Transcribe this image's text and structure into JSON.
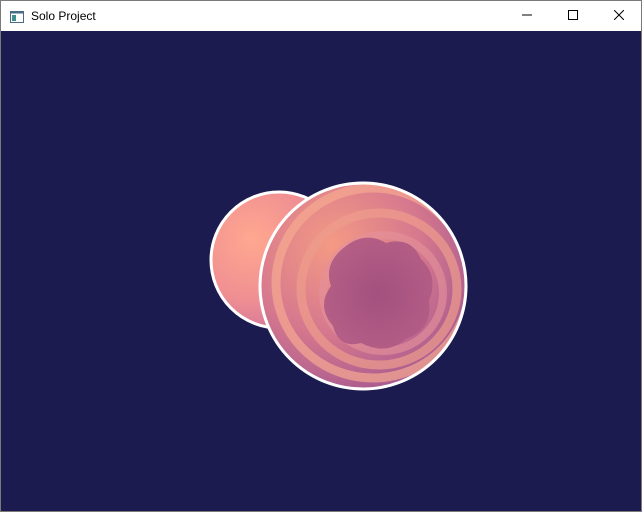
{
  "window": {
    "title": "Solo Project",
    "app_icon": "window-app-icon",
    "controls": {
      "minimize_icon": "minimize-icon",
      "maximize_icon": "maximize-icon",
      "close_icon": "close-icon"
    }
  },
  "scene": {
    "background_color": "#1b1b4f",
    "outline_color": "#ffffff",
    "spheres": [
      {
        "name": "back-sphere",
        "colors": [
          "#ffa48a",
          "#e07a9a",
          "#b86aa4"
        ]
      },
      {
        "name": "front-sphere",
        "colors": [
          "#f59a82",
          "#c8688e",
          "#8e4c86"
        ]
      }
    ]
  }
}
